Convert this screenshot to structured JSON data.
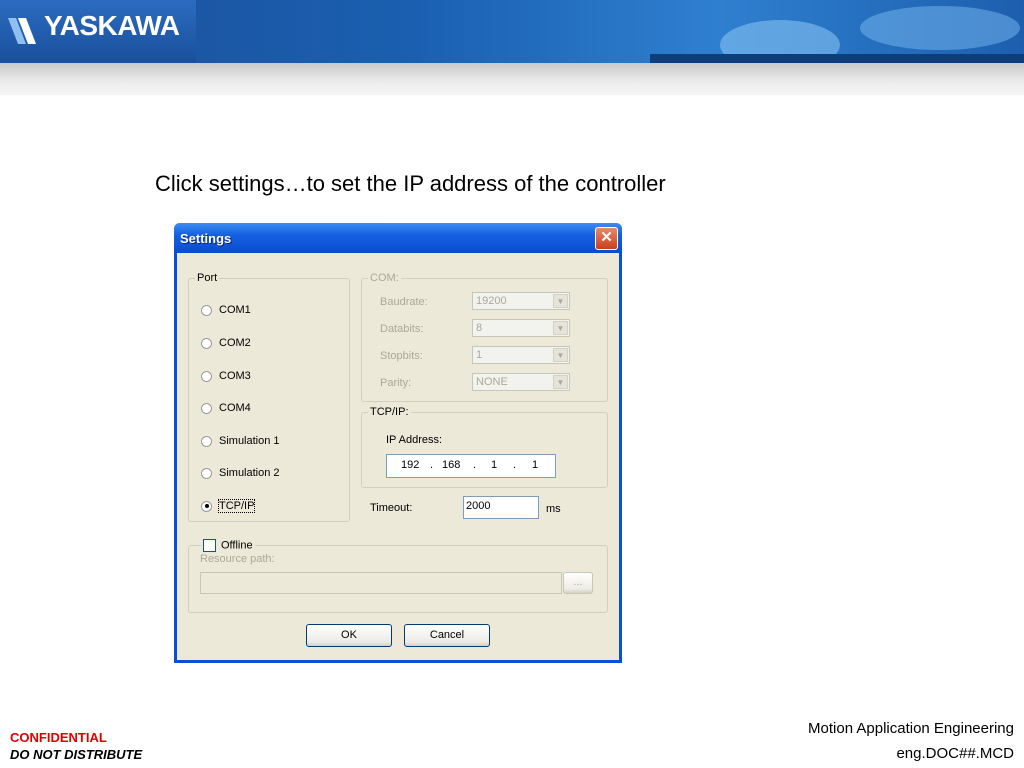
{
  "brand": {
    "logo_text": "YASKAWA"
  },
  "instruction": "Click settings…to set the IP address of the controller",
  "dialog": {
    "title": "Settings",
    "close_glyph": "✕",
    "port": {
      "legend": "Port",
      "options": [
        "COM1",
        "COM2",
        "COM3",
        "COM4",
        "Simulation 1",
        "Simulation 2",
        "TCP/IP"
      ],
      "selected": "TCP/IP"
    },
    "com": {
      "legend": "COM:",
      "baudrate_label": "Baudrate:",
      "baudrate_value": "19200",
      "databits_label": "Databits:",
      "databits_value": "8",
      "stopbits_label": "Stopbits:",
      "stopbits_value": "1",
      "parity_label": "Parity:",
      "parity_value": "NONE"
    },
    "tcpip": {
      "legend": "TCP/IP:",
      "ip_label": "IP Address:",
      "ip_octets": [
        "192",
        "168",
        "1",
        "1"
      ],
      "dot": "."
    },
    "timeout": {
      "label": "Timeout:",
      "value": "2000",
      "unit": "ms"
    },
    "offline": {
      "label": "Offline",
      "checked": false,
      "resource_label": "Resource path:",
      "resource_value": "",
      "browse_label": "..."
    },
    "ok_label": "OK",
    "cancel_label": "Cancel"
  },
  "footer": {
    "confidential": "CONFIDENTIAL",
    "do_not_distribute": "DO NOT DISTRIBUTE",
    "dept": "Motion Application Engineering",
    "doc": "eng.DOC##.MCD"
  },
  "colors": {
    "banner": "#1d4f9a",
    "titlebar": "#0b4bd0",
    "dialog_bg": "#ece9d8",
    "confidential": "#e00000"
  }
}
